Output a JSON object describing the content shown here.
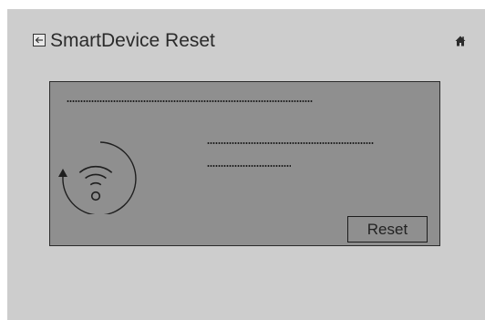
{
  "header": {
    "title": "SmartDevice Reset",
    "back_icon": "back-arrow-icon",
    "home_icon": "home-icon"
  },
  "panel": {
    "icon": "wifi-reset-icon",
    "reset_label": "Reset"
  },
  "colors": {
    "screen_bg": "#cdcdcd",
    "panel_bg": "#8f8f8f",
    "text": "#2b2b2b"
  }
}
